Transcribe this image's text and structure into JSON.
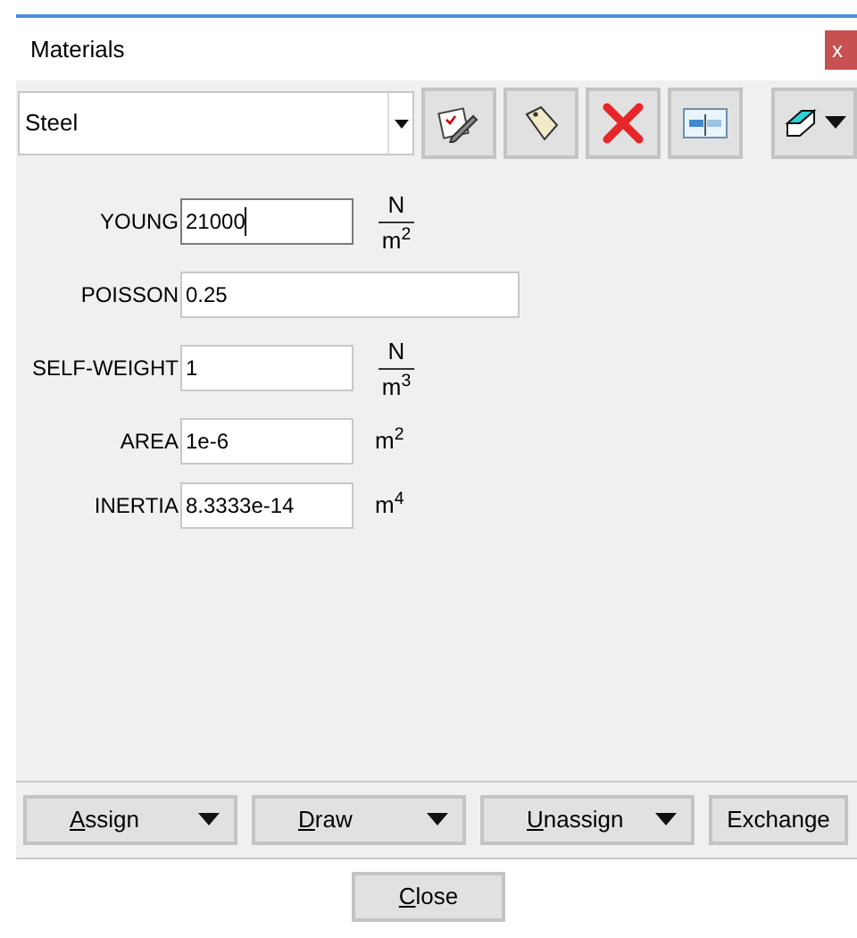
{
  "window": {
    "title": "Materials",
    "close": "x"
  },
  "material": {
    "value": "Steel"
  },
  "toolbar": [
    {
      "kind": "edit"
    },
    {
      "kind": "tag"
    },
    {
      "kind": "delete"
    },
    {
      "kind": "window"
    },
    {
      "kind": "eraser",
      "menu": true
    }
  ],
  "properties": [
    {
      "label": "YOUNG",
      "value": "21000",
      "focused": true,
      "kind": "fraction",
      "numerator": "N",
      "denominator": "m$^{2}$"
    },
    {
      "label": "POISSON",
      "value": "0.25",
      "focused": false,
      "kind": "none"
    },
    {
      "label": "SELF-WEIGHT",
      "value": "1",
      "focused": false,
      "kind": "fraction",
      "numerator": "N",
      "denominator": "m$^{3}$"
    },
    {
      "label": "AREA",
      "value": "1e-6",
      "focused": false,
      "kind": "power",
      "unit": "m$^{2}$"
    },
    {
      "label": "INERTIA",
      "value": "8.3333e-14",
      "focused": false,
      "kind": "power",
      "unit": "m$^{4}$"
    }
  ],
  "actions": [
    {
      "label": "Assign",
      "menu": true,
      "mnemonic": true
    },
    {
      "label": "Draw",
      "menu": true,
      "mnemonic": true
    },
    {
      "label": "Unassign",
      "menu": true,
      "mnemonic": true
    },
    {
      "label": "Exchange",
      "menu": false,
      "mnemonic": false
    }
  ],
  "close_button": {
    "label": "Close",
    "mnemonic": true
  }
}
